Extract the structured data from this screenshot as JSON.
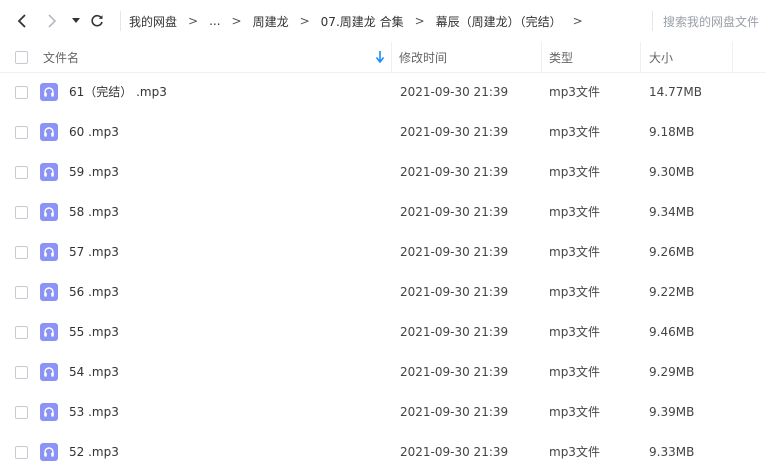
{
  "toolbar": {
    "back_icon": "chevron-left-icon",
    "forward_icon": "chevron-right-icon",
    "dropdown_icon": "caret-down-icon",
    "refresh_icon": "refresh-icon"
  },
  "breadcrumb": {
    "items": [
      "我的网盘",
      "...",
      "周建龙",
      "07.周建龙 合集",
      "幕辰（周建龙）（完结）"
    ],
    "separator": ">"
  },
  "search": {
    "placeholder": "搜索我的网盘文件"
  },
  "columns": {
    "name": "文件名",
    "modified": "修改时间",
    "type": "类型",
    "size": "大小",
    "sort_icon": "arrow-down-icon"
  },
  "colors": {
    "accent": "#1a8cff",
    "file_icon": "#8b93f7"
  },
  "files": [
    {
      "name": "61（完结） .mp3",
      "modified": "2021-09-30 21:39",
      "type": "mp3文件",
      "size": "14.77MB"
    },
    {
      "name": "60 .mp3",
      "modified": "2021-09-30 21:39",
      "type": "mp3文件",
      "size": "9.18MB"
    },
    {
      "name": "59 .mp3",
      "modified": "2021-09-30 21:39",
      "type": "mp3文件",
      "size": "9.30MB"
    },
    {
      "name": "58 .mp3",
      "modified": "2021-09-30 21:39",
      "type": "mp3文件",
      "size": "9.34MB"
    },
    {
      "name": "57 .mp3",
      "modified": "2021-09-30 21:39",
      "type": "mp3文件",
      "size": "9.26MB"
    },
    {
      "name": "56 .mp3",
      "modified": "2021-09-30 21:39",
      "type": "mp3文件",
      "size": "9.22MB"
    },
    {
      "name": "55 .mp3",
      "modified": "2021-09-30 21:39",
      "type": "mp3文件",
      "size": "9.46MB"
    },
    {
      "name": "54 .mp3",
      "modified": "2021-09-30 21:39",
      "type": "mp3文件",
      "size": "9.29MB"
    },
    {
      "name": "53 .mp3",
      "modified": "2021-09-30 21:39",
      "type": "mp3文件",
      "size": "9.39MB"
    },
    {
      "name": "52 .mp3",
      "modified": "2021-09-30 21:39",
      "type": "mp3文件",
      "size": "9.33MB"
    }
  ]
}
